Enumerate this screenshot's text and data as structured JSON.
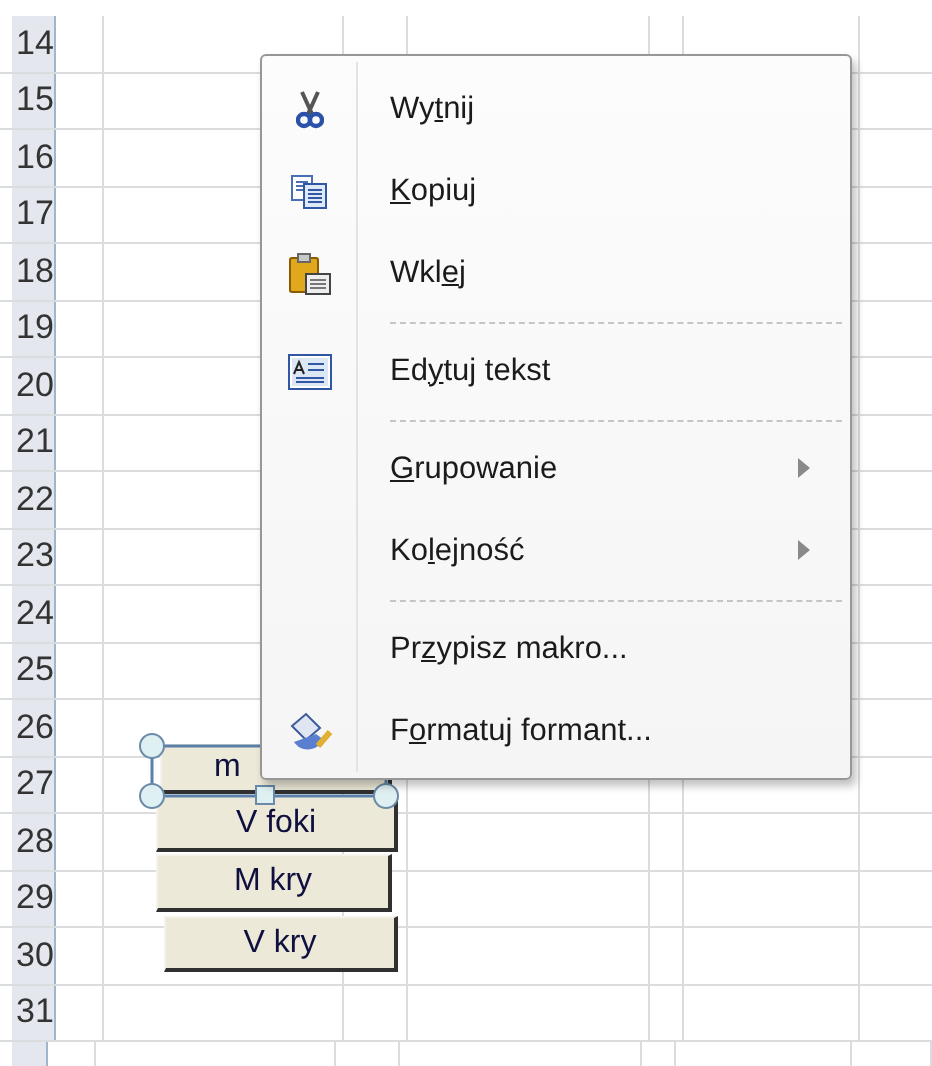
{
  "row_numbers": [
    "14",
    "15",
    "16",
    "17",
    "18",
    "19",
    "20",
    "21",
    "22",
    "23",
    "24",
    "25",
    "26",
    "27",
    "28",
    "29",
    "30",
    "31"
  ],
  "form_buttons": [
    {
      "label": "m",
      "selected": true
    },
    {
      "label": "V foki",
      "selected": false
    },
    {
      "label": "M kry",
      "selected": false
    },
    {
      "label": "V kry",
      "selected": false
    }
  ],
  "context_menu": {
    "items": [
      {
        "kind": "item",
        "before": "Wy",
        "key": "t",
        "after": "nij"
      },
      {
        "kind": "item",
        "key": "K",
        "after": "opiuj"
      },
      {
        "kind": "item",
        "before": "Wkl",
        "key": "e",
        "after": "j"
      },
      {
        "kind": "separator"
      },
      {
        "kind": "item",
        "before": "Ed",
        "key": "y",
        "after": "tuj tekst"
      },
      {
        "kind": "separator"
      },
      {
        "kind": "submenu",
        "key": "G",
        "after": "rupowanie"
      },
      {
        "kind": "submenu",
        "before": "Ko",
        "key": "l",
        "after": "ejność"
      },
      {
        "kind": "separator"
      },
      {
        "kind": "item",
        "before": "Pr",
        "key": "z",
        "after": "ypisz makro..."
      },
      {
        "kind": "item",
        "before": "F",
        "key": "o",
        "after": "rmatuj formant..."
      }
    ]
  }
}
